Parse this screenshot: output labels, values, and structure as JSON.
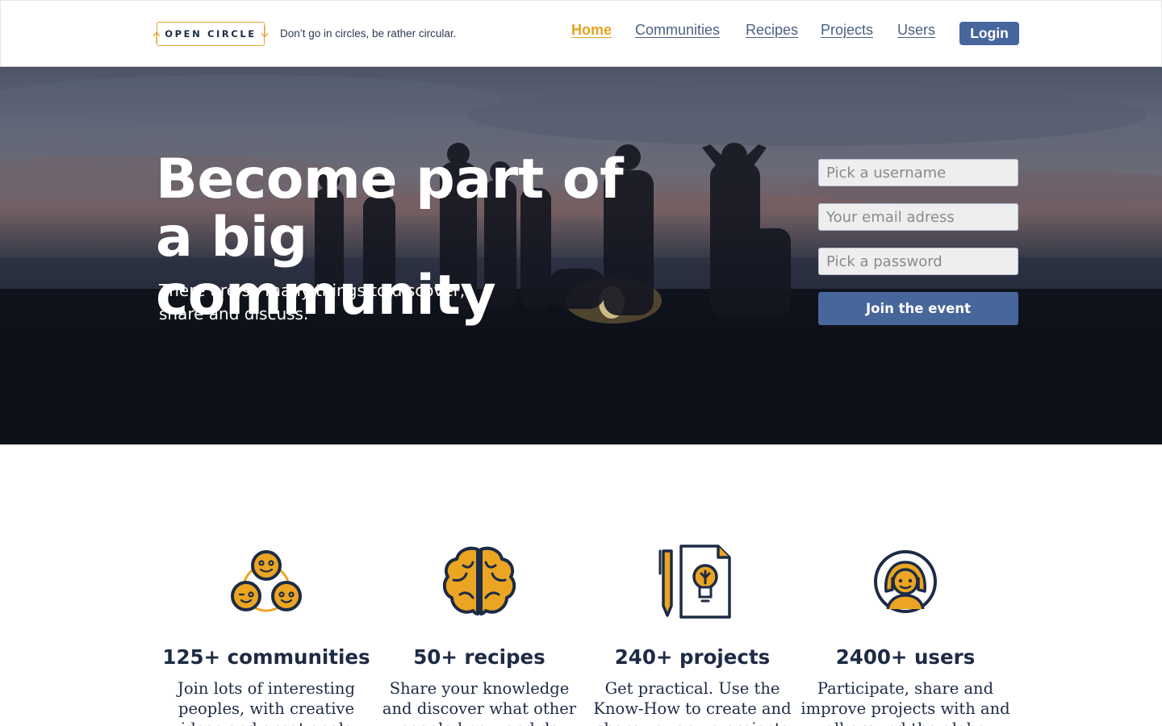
{
  "header": {
    "logo_text": "OPEN CIRCLE",
    "tagline": "Don’t go in circles, be rather circular.",
    "nav": [
      {
        "label": "Home",
        "active": true
      },
      {
        "label": "Communities",
        "active": false
      },
      {
        "label": "Recipes",
        "active": false
      },
      {
        "label": "Projects",
        "active": false
      },
      {
        "label": "Users",
        "active": false
      }
    ],
    "login_label": "Login"
  },
  "hero": {
    "title_line1": "Become part of",
    "title_line2": "a big community",
    "subtitle_line1": "There are so many things to discover,",
    "subtitle_line2": "share and discuss.",
    "form": {
      "username_placeholder": "Pick a username",
      "email_placeholder": "Your email adress",
      "password_placeholder": "Pick a password",
      "submit_label": "Join the event"
    }
  },
  "features": [
    {
      "icon": "faces-group-icon",
      "title": "125+ communities",
      "text": "Join lots of interesting peoples, with creative ideas and great goals"
    },
    {
      "icon": "brain-icon",
      "title": "50+ recipes",
      "text": "Share your knowledge and discover what other people know and do"
    },
    {
      "icon": "pencil-lightbulb-icon",
      "title": "240+ projects",
      "text": "Get practical. Use the Know-How to create and share your own projects"
    },
    {
      "icon": "user-avatar-icon",
      "title": "2400+ users",
      "text": "Participate, share and improve projects with and all around the globe"
    }
  ],
  "colors": {
    "accent": "#e8a21f",
    "primary": "#47669b",
    "text_dark": "#1d2b45",
    "icon_fill": "#eba522",
    "icon_stroke": "#1d2b45"
  }
}
